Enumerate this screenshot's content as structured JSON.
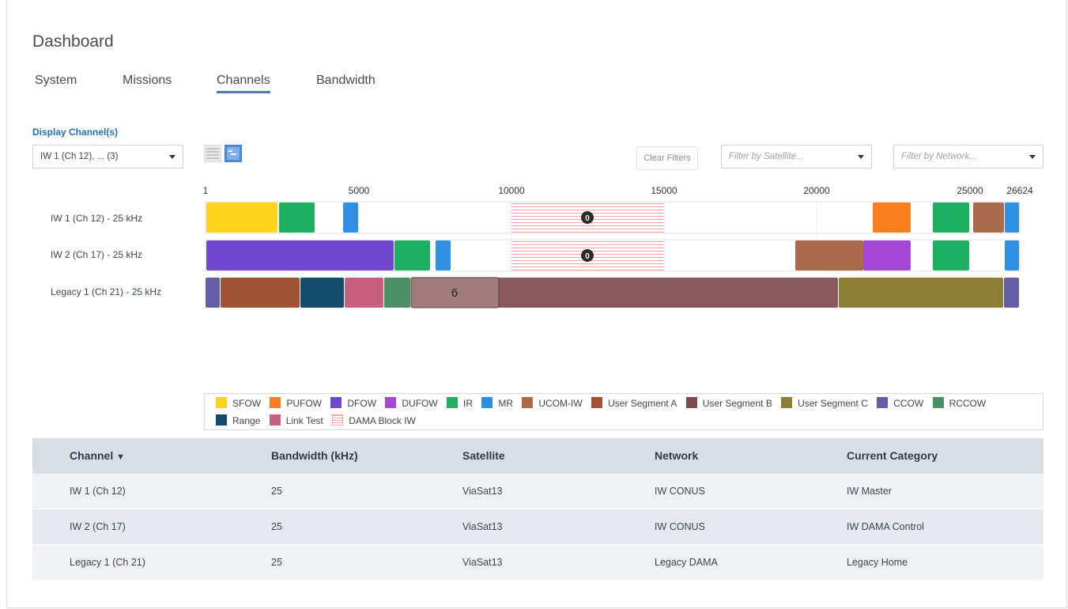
{
  "page": {
    "title": "Dashboard"
  },
  "tabs": [
    {
      "label": "System"
    },
    {
      "label": "Missions"
    },
    {
      "label": "Channels",
      "active": true
    },
    {
      "label": "Bandwidth"
    }
  ],
  "filters": {
    "display_label": "Display Channel(s)",
    "display_value": "IW 1 (Ch 12), ... (3)",
    "clear_label": "Clear Filters",
    "satellite_placeholder": "Filter by Satellite...",
    "network_placeholder": "Filter by Network..."
  },
  "view_toggle": {
    "list_icon": "list-view-icon",
    "timeline_icon": "timeline-view-icon",
    "active": "timeline"
  },
  "chart": {
    "axis_ticks": [
      "1",
      "5000",
      "10000",
      "15000",
      "20000",
      "25000",
      "26624"
    ],
    "channels": [
      {
        "label": "IW 1 (Ch 12) - 25 kHz",
        "dama_count": "0"
      },
      {
        "label": "IW 2 (Ch 17) - 25 kHz",
        "dama_count": "0"
      },
      {
        "label": "Legacy 1 (Ch 21) - 25 kHz",
        "selected_count": "6"
      }
    ]
  },
  "colors": {
    "SFOW": "#fdd419",
    "PUFOW": "#fa7d1e",
    "DFOW": "#7247d0",
    "DUFOW": "#a646d6",
    "IR": "#1db062",
    "MR": "#2f8fe0",
    "UCOM-IW": "#a86a48",
    "User Segment A": "#a15234",
    "User Segment B": "#7e4a4e",
    "User Segment C": "#8c7e34",
    "CCOW": "#635ea6",
    "RCCOW": "#4c9166",
    "Range": "#144c6e",
    "Link Test": "#c66080",
    "DAMA Block IW": "#f3a6a6",
    "accent": "#1f6fba"
  },
  "legend": {
    "row1": [
      "SFOW",
      "PUFOW",
      "DFOW",
      "DUFOW",
      "IR",
      "MR",
      "UCOM-IW",
      "User Segment A",
      "User Segment B",
      "User Segment C",
      "CCOW",
      "RCCOW"
    ],
    "row2": [
      "Range",
      "Link Test",
      "DAMA Block IW"
    ]
  },
  "table": {
    "headers": {
      "channel": "Channel",
      "bandwidth": "Bandwidth (kHz)",
      "satellite": "Satellite",
      "network": "Network",
      "category": "Current Category"
    },
    "sort_indicator": "▼",
    "rows": [
      {
        "channel": "IW 1 (Ch 12)",
        "bandwidth": "25",
        "satellite": "ViaSat13",
        "network": "IW CONUS",
        "category": "IW Master"
      },
      {
        "channel": "IW 2 (Ch 17)",
        "bandwidth": "25",
        "satellite": "ViaSat13",
        "network": "IW CONUS",
        "category": "IW DAMA Control"
      },
      {
        "channel": "Legacy 1 (Ch 21)",
        "bandwidth": "25",
        "satellite": "ViaSat13",
        "network": "Legacy DAMA",
        "category": "Legacy Home"
      }
    ]
  }
}
